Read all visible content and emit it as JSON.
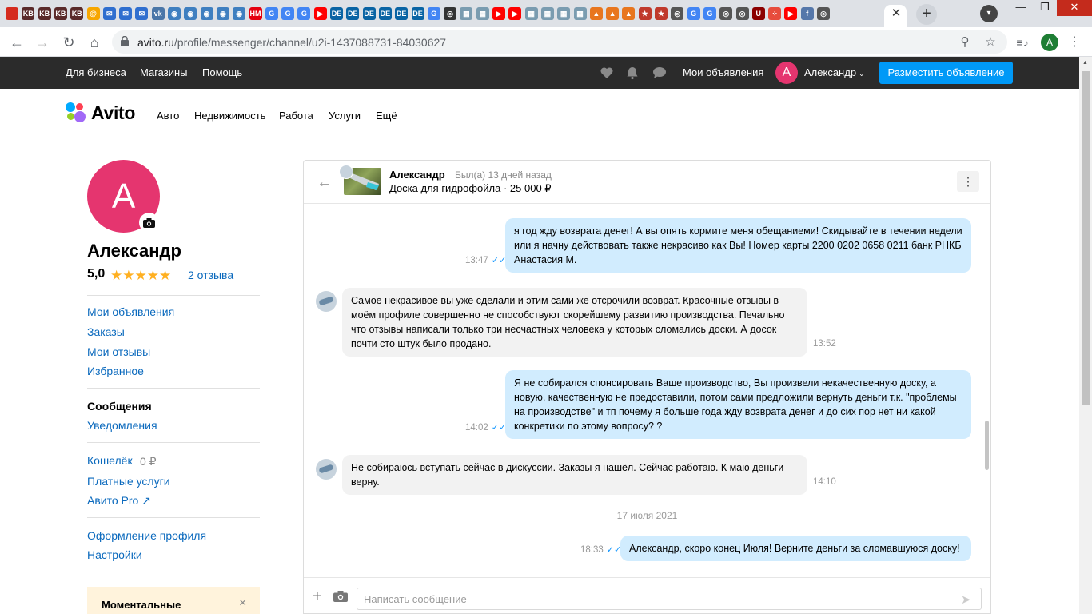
{
  "browser": {
    "url_host": "avito.ru",
    "url_path": "/profile/messenger/channel/u2i-1437088731-84030627",
    "tabs": [
      {
        "icon": "flag-ru-icon",
        "color": "#d52b1e",
        "glyph": ""
      },
      {
        "icon": "kb-icon",
        "color": "#5a2a2a",
        "glyph": "KB"
      },
      {
        "icon": "kb-icon",
        "color": "#5a2a2a",
        "glyph": "KB"
      },
      {
        "icon": "kb-icon",
        "color": "#5a2a2a",
        "glyph": "KB"
      },
      {
        "icon": "kb-icon",
        "color": "#5a2a2a",
        "glyph": "KB"
      },
      {
        "icon": "mail-at-icon",
        "color": "#f7a600",
        "glyph": "@"
      },
      {
        "icon": "mail-icon",
        "color": "#2f6ecf",
        "glyph": "✉"
      },
      {
        "icon": "mail-icon",
        "color": "#2f6ecf",
        "glyph": "✉"
      },
      {
        "icon": "mail-icon",
        "color": "#2f6ecf",
        "glyph": "✉"
      },
      {
        "icon": "vk-icon",
        "color": "#4a76a8",
        "glyph": "vk"
      },
      {
        "icon": "site-icon",
        "color": "#3f7fc0",
        "glyph": "◉"
      },
      {
        "icon": "site-icon",
        "color": "#3f7fc0",
        "glyph": "◉"
      },
      {
        "icon": "site-icon",
        "color": "#3f7fc0",
        "glyph": "◉"
      },
      {
        "icon": "site-icon",
        "color": "#3f7fc0",
        "glyph": "◉"
      },
      {
        "icon": "site-icon",
        "color": "#3f7fc0",
        "glyph": "◉"
      },
      {
        "icon": "hm-icon",
        "color": "#e50010",
        "glyph": "HM"
      },
      {
        "icon": "google-icon",
        "color": "#4285f4",
        "glyph": "G"
      },
      {
        "icon": "google-icon",
        "color": "#4285f4",
        "glyph": "G"
      },
      {
        "icon": "google-icon",
        "color": "#4285f4",
        "glyph": "G"
      },
      {
        "icon": "youtube-icon",
        "color": "#ff0000",
        "glyph": "▶"
      },
      {
        "icon": "de-icon",
        "color": "#0a64a4",
        "glyph": "DE"
      },
      {
        "icon": "de-icon",
        "color": "#0a64a4",
        "glyph": "DE"
      },
      {
        "icon": "de-icon",
        "color": "#0a64a4",
        "glyph": "DE"
      },
      {
        "icon": "de-icon",
        "color": "#0a64a4",
        "glyph": "DE"
      },
      {
        "icon": "de-icon",
        "color": "#0a64a4",
        "glyph": "DE"
      },
      {
        "icon": "de-icon",
        "color": "#0a64a4",
        "glyph": "DE"
      },
      {
        "icon": "google-icon",
        "color": "#4285f4",
        "glyph": "G"
      },
      {
        "icon": "eye-icon",
        "color": "#333333",
        "glyph": "◎"
      },
      {
        "icon": "grid-icon",
        "color": "#7a9cb0",
        "glyph": "▦"
      },
      {
        "icon": "grid-icon",
        "color": "#7a9cb0",
        "glyph": "▦"
      },
      {
        "icon": "youtube-icon",
        "color": "#ff0000",
        "glyph": "▶"
      },
      {
        "icon": "youtube-icon",
        "color": "#ff0000",
        "glyph": "▶"
      },
      {
        "icon": "grid-icon",
        "color": "#7a9cb0",
        "glyph": "▦"
      },
      {
        "icon": "grid-icon",
        "color": "#7a9cb0",
        "glyph": "▦"
      },
      {
        "icon": "grid-icon",
        "color": "#7a9cb0",
        "glyph": "▦"
      },
      {
        "icon": "grid-icon",
        "color": "#7a9cb0",
        "glyph": "▦"
      },
      {
        "icon": "fox-icon",
        "color": "#e8761e",
        "glyph": "▲"
      },
      {
        "icon": "fox-icon",
        "color": "#e8761e",
        "glyph": "▲"
      },
      {
        "icon": "fox-icon",
        "color": "#e8761e",
        "glyph": "▲"
      },
      {
        "icon": "star-icon",
        "color": "#c0392b",
        "glyph": "★"
      },
      {
        "icon": "star-icon",
        "color": "#c0392b",
        "glyph": "★"
      },
      {
        "icon": "chrome-icon",
        "color": "#555555",
        "glyph": "◎"
      },
      {
        "icon": "google-icon",
        "color": "#4285f4",
        "glyph": "G"
      },
      {
        "icon": "google-icon",
        "color": "#4285f4",
        "glyph": "G"
      },
      {
        "icon": "chrome-icon",
        "color": "#555555",
        "glyph": "◎"
      },
      {
        "icon": "chrome-icon",
        "color": "#555555",
        "glyph": "◎"
      },
      {
        "icon": "ublock-icon",
        "color": "#8b0000",
        "glyph": "U"
      },
      {
        "icon": "dots-icon",
        "color": "#e74c3c",
        "glyph": "⁘"
      },
      {
        "icon": "youtube-icon",
        "color": "#ff0000",
        "glyph": "▶"
      },
      {
        "icon": "forum-icon",
        "color": "#5577aa",
        "glyph": "f"
      },
      {
        "icon": "chrome-icon",
        "color": "#555555",
        "glyph": "◎"
      }
    ]
  },
  "topbar": {
    "business": "Для бизнеса",
    "shops": "Магазины",
    "help": "Помощь",
    "my_ads": "Мои объявления",
    "user_initial": "А",
    "user_name": "Александр",
    "post_ad": "Разместить объявление"
  },
  "header": {
    "logo": "Avito",
    "nav": [
      "Авто",
      "Недвижимость",
      "Работа",
      "Услуги",
      "Ещё"
    ]
  },
  "sidebar": {
    "avatar_initial": "А",
    "name": "Александр",
    "rating": "5,0",
    "stars": "★★★★★",
    "reviews": "2 отзыва",
    "group1": [
      "Мои объявления",
      "Заказы",
      "Мои отзывы",
      "Избранное"
    ],
    "active": "Сообщения",
    "notifications": "Уведомления",
    "wallet": "Кошелёк",
    "wallet_amount": "0 ₽",
    "paid": "Платные услуги",
    "pro": "Авито Pro",
    "profile_design": "Оформление профиля",
    "settings": "Настройки",
    "promo_title": "Моментальные"
  },
  "chat": {
    "interlocutor": "Александр",
    "last_seen": "Был(а) 13 дней назад",
    "item": "Доска для гидрофойла · 25 000 ₽",
    "input_placeholder": "Написать сообщение",
    "messages": [
      {
        "dir": "out",
        "time": "13:47",
        "text": "я год жду возврата денег! А вы опять кормите меня обещаниеми! Скидывайте в течении недели или я начну действовать также некрасиво как Вы!  Номер карты 2200 0202 0658 0211 банк РНКБ Анастасия М."
      },
      {
        "dir": "in",
        "time": "13:52",
        "text": "Самое некрасивое вы уже сделали и этим сами же отсрочили возврат. Красочные отзывы в моём профиле совершенно не способствуют скорейшему развитию производства. Печально что отзывы написали только три несчастных человека у которых сломались доски. А досок почти сто штук было продано."
      },
      {
        "dir": "out",
        "time": "14:02",
        "text": "Я не собирался спонсировать Ваше производство, Вы произвели некачественную доску, а новую, качественную не предоставили, потом сами предложили вернуть деньги т.к. \"проблемы на производстве\" и тп почему я больше года жду возврата денег и до сих пор нет ни какой конкретики по этому вопросу? ?"
      },
      {
        "dir": "in",
        "time": "14:10",
        "text": "Не собираюсь вступать сейчас в дискуссии. Заказы я нашёл. Сейчас работаю. К маю деньги верну."
      },
      {
        "dir": "out",
        "time": "18:33",
        "text": "Александр, скоро конец Июля! Верните деньги за сломавшуюся доску!"
      }
    ],
    "date_separator": "17 июля 2021"
  }
}
